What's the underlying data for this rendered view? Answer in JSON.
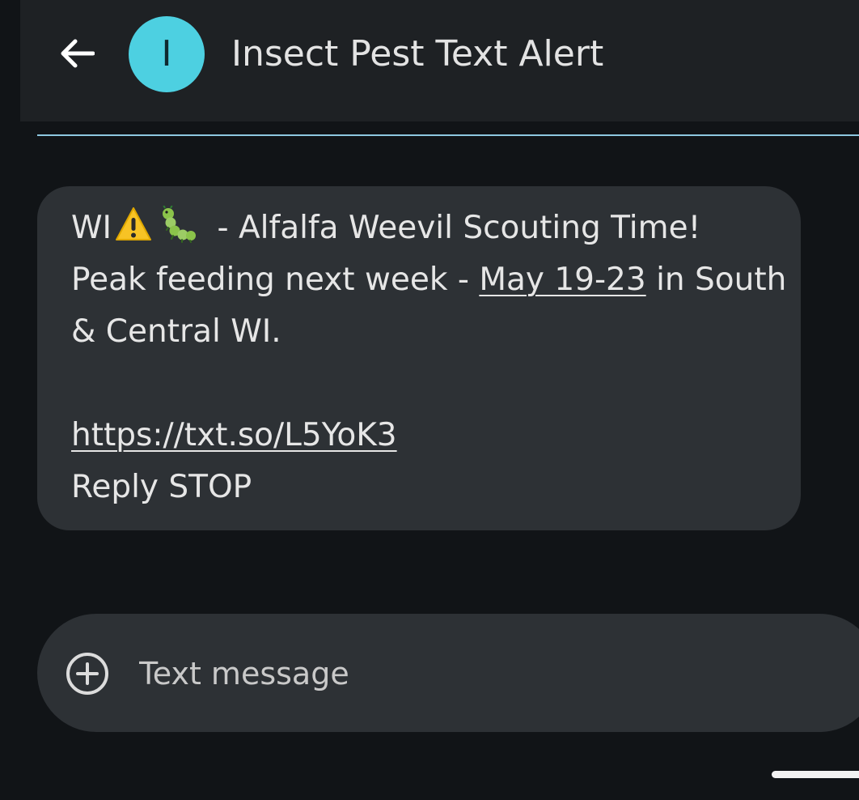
{
  "header": {
    "back_icon": "arrow-left-icon",
    "avatar_letter": "I",
    "avatar_color": "#4dd0e1",
    "title": "Insect Pest Text Alert"
  },
  "message": {
    "line1_prefix": "WI",
    "line1_icons": [
      "warning-emoji-icon",
      "caterpillar-emoji-icon"
    ],
    "line1_text": " - Alfalfa Weevil Scouting Time!",
    "line2_text": "Peak feeding next week - ",
    "line2_link": "May 19-23",
    "line2_suffix": " in South",
    "line3_text": "& Central WI.",
    "link_url": "https://txt.so/L5YoK3",
    "footer": "Reply STOP"
  },
  "compose": {
    "add_icon": "add-circle-icon",
    "placeholder": "Text message"
  },
  "colors": {
    "background": "#111417",
    "header_bg": "#1e2124",
    "bubble_bg": "#2d3135",
    "divider": "#8ec8e0"
  }
}
